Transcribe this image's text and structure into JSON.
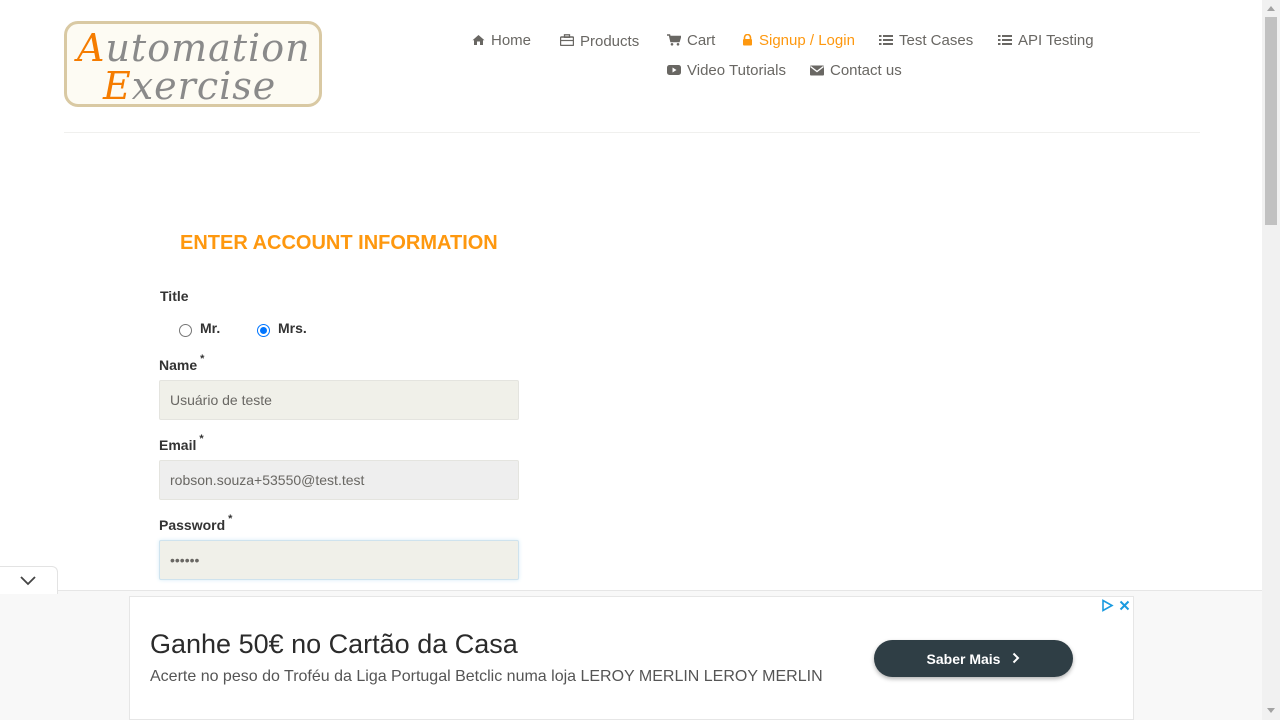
{
  "logo": {
    "line1_cap": "A",
    "line1_rest": "utomation",
    "line2_cap": "E",
    "line2_rest": "xercise"
  },
  "nav": {
    "items": [
      {
        "label": "Home",
        "icon": "home-icon"
      },
      {
        "label": "Products",
        "icon": "briefcase-icon"
      },
      {
        "label": "Cart",
        "icon": "cart-icon"
      },
      {
        "label": "Signup / Login",
        "icon": "lock-icon",
        "active": true
      },
      {
        "label": "Test Cases",
        "icon": "list-icon"
      },
      {
        "label": "API Testing",
        "icon": "list-icon"
      },
      {
        "label": "Video Tutorials",
        "icon": "youtube-play-icon"
      },
      {
        "label": "Contact us",
        "icon": "envelope-icon"
      }
    ]
  },
  "form": {
    "title": "ENTER ACCOUNT INFORMATION",
    "title_label": "Title",
    "title_options": [
      {
        "label": "Mr.",
        "checked": false
      },
      {
        "label": "Mrs.",
        "checked": true
      }
    ],
    "name": {
      "label": "Name",
      "required_mark": "*",
      "value": "Usuário de teste"
    },
    "email": {
      "label": "Email",
      "required_mark": "*",
      "value": "robson.souza+53550@test.test"
    },
    "password": {
      "label": "Password",
      "required_mark": "*",
      "value": "••••••"
    }
  },
  "ad": {
    "headline": "Ganhe 50€ no Cartão da Casa",
    "body": "Acerte no peso do Troféu da Liga Portugal Betclic numa loja LEROY MERLIN LEROY MERLIN",
    "cta": "Saber Mais"
  },
  "colors": {
    "accent": "#fe980f",
    "text": "#696763",
    "input_bg": "#f0f0e9",
    "cta_bg": "#2f3e45"
  }
}
